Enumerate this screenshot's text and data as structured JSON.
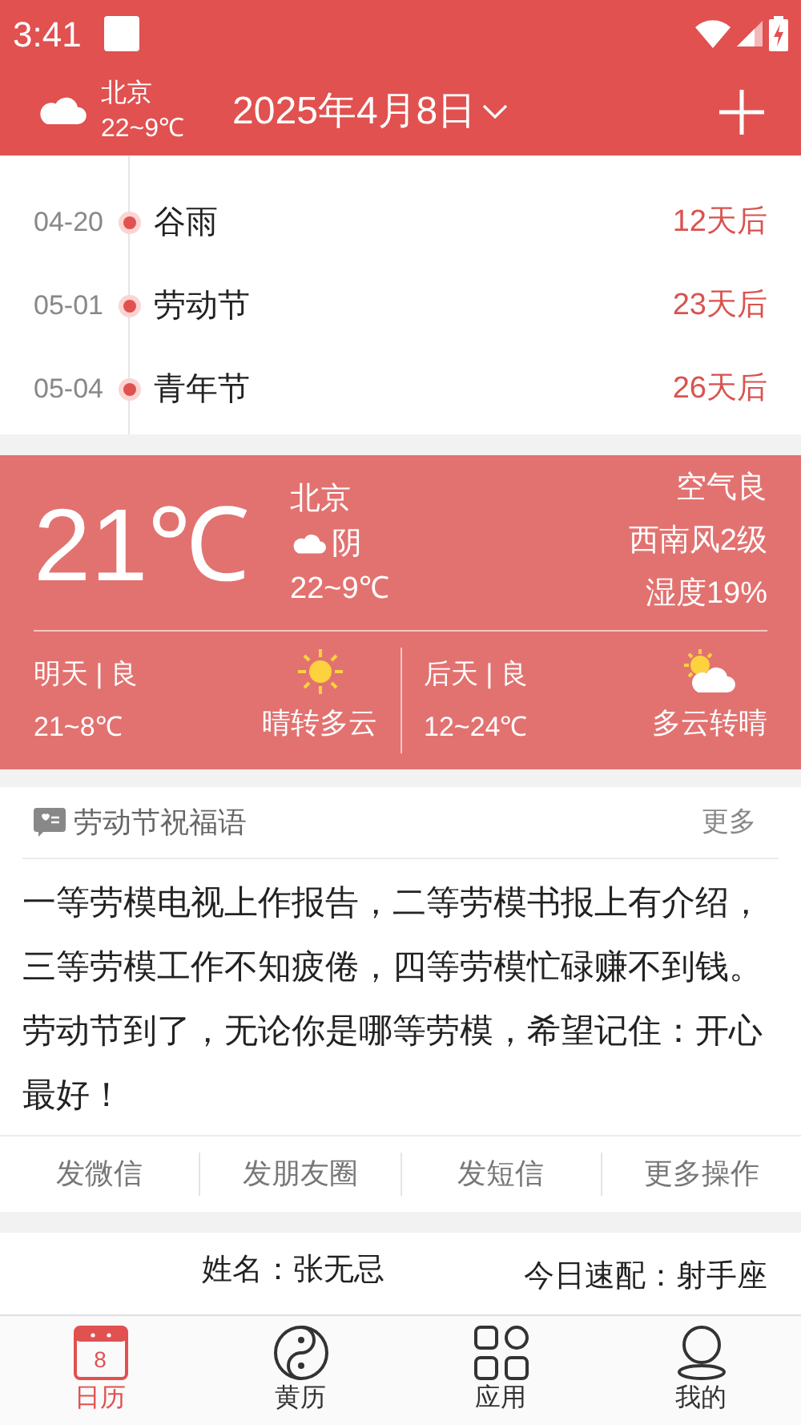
{
  "status_bar": {
    "time": "3:41"
  },
  "header": {
    "city": "北京",
    "temp_range": "22~9℃",
    "date": "2025年4月8日"
  },
  "events": [
    {
      "date": "04-20",
      "name": "谷雨",
      "countdown": "12天后"
    },
    {
      "date": "05-01",
      "name": "劳动节",
      "countdown": "23天后"
    },
    {
      "date": "05-04",
      "name": "青年节",
      "countdown": "26天后"
    }
  ],
  "weather": {
    "temp": "21℃",
    "city": "北京",
    "condition": "阴",
    "range": "22~9℃",
    "air": "空气良",
    "wind": "西南风2级",
    "humidity": "湿度19%",
    "forecast": [
      {
        "day": "明天 | 良",
        "range": "21~8℃",
        "condition": "晴转多云",
        "kind": "sunny"
      },
      {
        "day": "后天 | 良",
        "range": "12~24℃",
        "condition": "多云转晴",
        "kind": "partly"
      }
    ]
  },
  "blessing": {
    "title": "劳动节祝福语",
    "more": "更多",
    "text": "一等劳模电视上作报告，二等劳模书报上有介绍，三等劳模工作不知疲倦，四等劳模忙碌赚不到钱。劳动节到了，无论你是哪等劳模，希望记住：开心最好！",
    "actions": [
      "发微信",
      "发朋友圈",
      "发短信",
      "更多操作"
    ]
  },
  "profile": {
    "name": "姓名：张无忌",
    "match": "今日速配：射手座"
  },
  "nav": [
    {
      "label": "日历",
      "kind": "calendar",
      "selected": true,
      "day": "8"
    },
    {
      "label": "黄历",
      "kind": "yinyang",
      "selected": false
    },
    {
      "label": "应用",
      "kind": "apps",
      "selected": false
    },
    {
      "label": "我的",
      "kind": "person",
      "selected": false
    }
  ]
}
